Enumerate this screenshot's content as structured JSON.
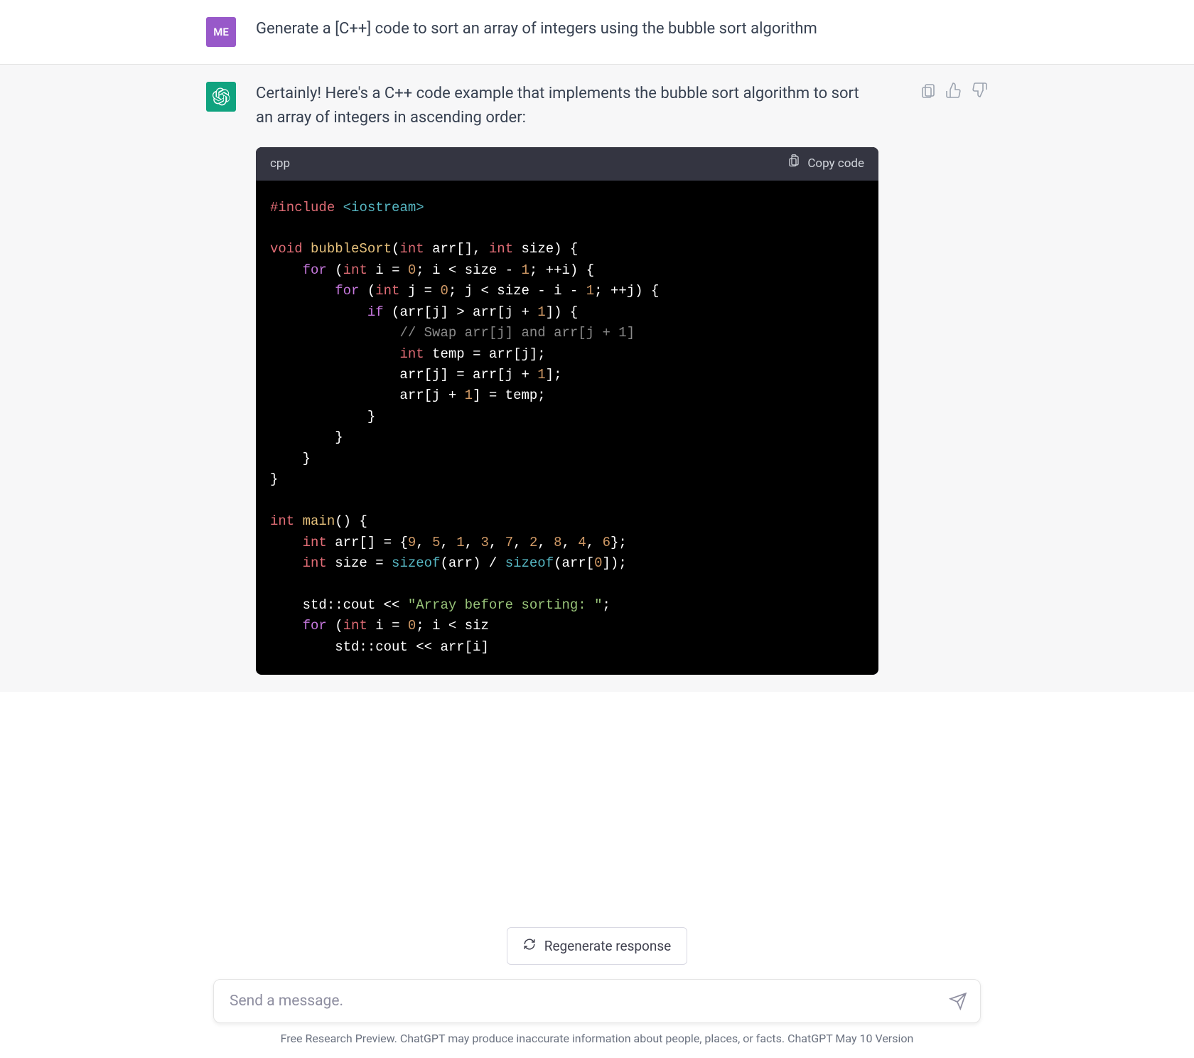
{
  "user": {
    "avatar_label": "ME",
    "message": "Generate a [C++] code to sort an array of integers using the bubble sort algorithm"
  },
  "assistant": {
    "intro": "Certainly! Here's a C++ code example that implements the bubble sort algorithm to sort an array of integers in ascending order:"
  },
  "codeblock": {
    "language": "cpp",
    "copy_label": "Copy code",
    "code_tokens": [
      [
        {
          "c": "k-preprocessor",
          "t": "#"
        },
        {
          "c": "k-preprocessor",
          "t": "include"
        },
        {
          "t": " "
        },
        {
          "c": "k-include",
          "t": "<iostream>"
        }
      ],
      [],
      [
        {
          "c": "k-type",
          "t": "void"
        },
        {
          "t": " "
        },
        {
          "c": "k-func",
          "t": "bubbleSort"
        },
        {
          "t": "("
        },
        {
          "c": "k-type",
          "t": "int"
        },
        {
          "t": " arr[], "
        },
        {
          "c": "k-type",
          "t": "int"
        },
        {
          "t": " size) {"
        }
      ],
      [
        {
          "t": "    "
        },
        {
          "c": "k-for",
          "t": "for"
        },
        {
          "t": " ("
        },
        {
          "c": "k-type",
          "t": "int"
        },
        {
          "t": " i = "
        },
        {
          "c": "k-number",
          "t": "0"
        },
        {
          "t": "; i < size - "
        },
        {
          "c": "k-number",
          "t": "1"
        },
        {
          "t": "; ++i) {"
        }
      ],
      [
        {
          "t": "        "
        },
        {
          "c": "k-for",
          "t": "for"
        },
        {
          "t": " ("
        },
        {
          "c": "k-type",
          "t": "int"
        },
        {
          "t": " j = "
        },
        {
          "c": "k-number",
          "t": "0"
        },
        {
          "t": "; j < size - i - "
        },
        {
          "c": "k-number",
          "t": "1"
        },
        {
          "t": "; ++j) {"
        }
      ],
      [
        {
          "t": "            "
        },
        {
          "c": "k-for",
          "t": "if"
        },
        {
          "t": " (arr[j] > arr[j + "
        },
        {
          "c": "k-number",
          "t": "1"
        },
        {
          "t": "]) {"
        }
      ],
      [
        {
          "t": "                "
        },
        {
          "c": "k-comment",
          "t": "// Swap arr[j] and arr[j + 1]"
        }
      ],
      [
        {
          "t": "                "
        },
        {
          "c": "k-type",
          "t": "int"
        },
        {
          "t": " temp = arr[j];"
        }
      ],
      [
        {
          "t": "                arr[j] = arr[j + "
        },
        {
          "c": "k-number",
          "t": "1"
        },
        {
          "t": "];"
        }
      ],
      [
        {
          "t": "                arr[j + "
        },
        {
          "c": "k-number",
          "t": "1"
        },
        {
          "t": "] = temp;"
        }
      ],
      [
        {
          "t": "            }"
        }
      ],
      [
        {
          "t": "        }"
        }
      ],
      [
        {
          "t": "    }"
        }
      ],
      [
        {
          "t": "}"
        }
      ],
      [],
      [
        {
          "c": "k-type",
          "t": "int"
        },
        {
          "t": " "
        },
        {
          "c": "k-func",
          "t": "main"
        },
        {
          "t": "() {"
        }
      ],
      [
        {
          "t": "    "
        },
        {
          "c": "k-type",
          "t": "int"
        },
        {
          "t": " arr[] = {"
        },
        {
          "c": "k-number",
          "t": "9"
        },
        {
          "t": ", "
        },
        {
          "c": "k-number",
          "t": "5"
        },
        {
          "t": ", "
        },
        {
          "c": "k-number",
          "t": "1"
        },
        {
          "t": ", "
        },
        {
          "c": "k-number",
          "t": "3"
        },
        {
          "t": ", "
        },
        {
          "c": "k-number",
          "t": "7"
        },
        {
          "t": ", "
        },
        {
          "c": "k-number",
          "t": "2"
        },
        {
          "t": ", "
        },
        {
          "c": "k-number",
          "t": "8"
        },
        {
          "t": ", "
        },
        {
          "c": "k-number",
          "t": "4"
        },
        {
          "t": ", "
        },
        {
          "c": "k-number",
          "t": "6"
        },
        {
          "t": "};"
        }
      ],
      [
        {
          "t": "    "
        },
        {
          "c": "k-type",
          "t": "int"
        },
        {
          "t": " size = "
        },
        {
          "c": "k-builtin",
          "t": "sizeof"
        },
        {
          "t": "(arr) / "
        },
        {
          "c": "k-builtin",
          "t": "sizeof"
        },
        {
          "t": "(arr["
        },
        {
          "c": "k-number",
          "t": "0"
        },
        {
          "t": "]);"
        }
      ],
      [],
      [
        {
          "t": "    std::cout << "
        },
        {
          "c": "k-string",
          "t": "\"Array before sorting: \""
        },
        {
          "t": ";"
        }
      ],
      [
        {
          "t": "    "
        },
        {
          "c": "k-for",
          "t": "for"
        },
        {
          "t": " ("
        },
        {
          "c": "k-type",
          "t": "int"
        },
        {
          "t": " i = "
        },
        {
          "c": "k-number",
          "t": "0"
        },
        {
          "t": "; i < siz"
        }
      ],
      [
        {
          "t": "        std::cout << arr[i]"
        }
      ]
    ]
  },
  "controls": {
    "regenerate_label": "Regenerate response"
  },
  "input": {
    "placeholder": "Send a message."
  },
  "footer": {
    "text": "Free Research Preview. ChatGPT may produce inaccurate information about people, places, or facts. ChatGPT May 10 Version"
  }
}
